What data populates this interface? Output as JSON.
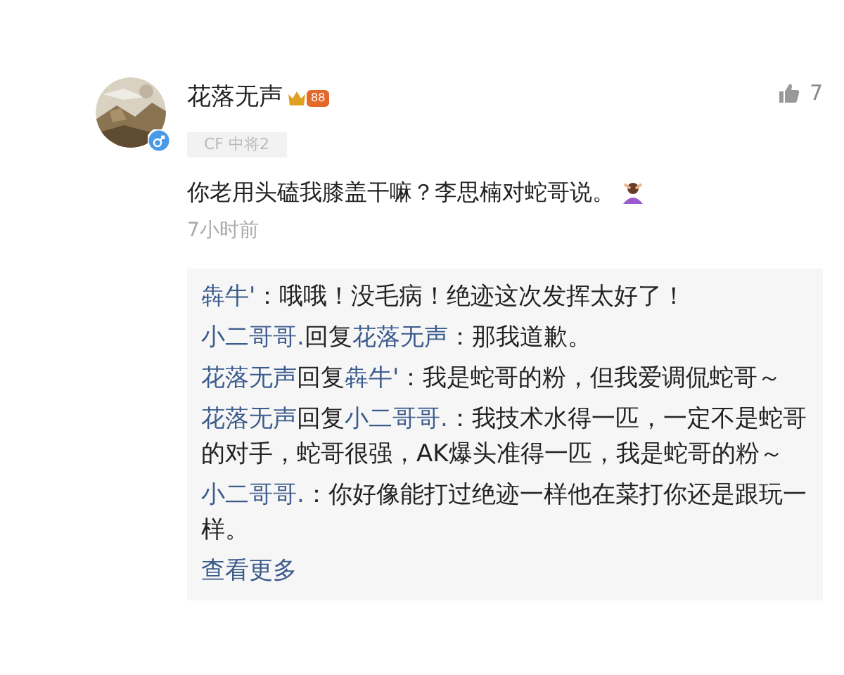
{
  "comment": {
    "author": "花落无声",
    "level_badge": "88",
    "title_badge": "CF 中将2",
    "likes": "7",
    "text": "你老用头磕我膝盖干嘛？李思楠对蛇哥说。",
    "time": "7小时前"
  },
  "replies": [
    {
      "author": "犇牛'",
      "text": "：哦哦！没毛病！绝迹这次发挥太好了！"
    },
    {
      "author": "小二哥哥.",
      "reply_word": "回复",
      "reply_to": "花落无声",
      "text": "：那我道歉。"
    },
    {
      "author": "花落无声",
      "reply_word": "回复",
      "reply_to": "犇牛'",
      "text": "：我是蛇哥的粉，但我爱调侃蛇哥～"
    },
    {
      "author": "花落无声",
      "reply_word": "回复",
      "reply_to": "小二哥哥.",
      "text": "：我技术水得一匹，一定不是蛇哥的对手，蛇哥很强，AK爆头准得一匹，我是蛇哥的粉～"
    },
    {
      "author": "小二哥哥.",
      "text": "：你好像能打过绝迹一样他在菜打你还是跟玩一样。"
    }
  ],
  "more_link": "查看更多"
}
